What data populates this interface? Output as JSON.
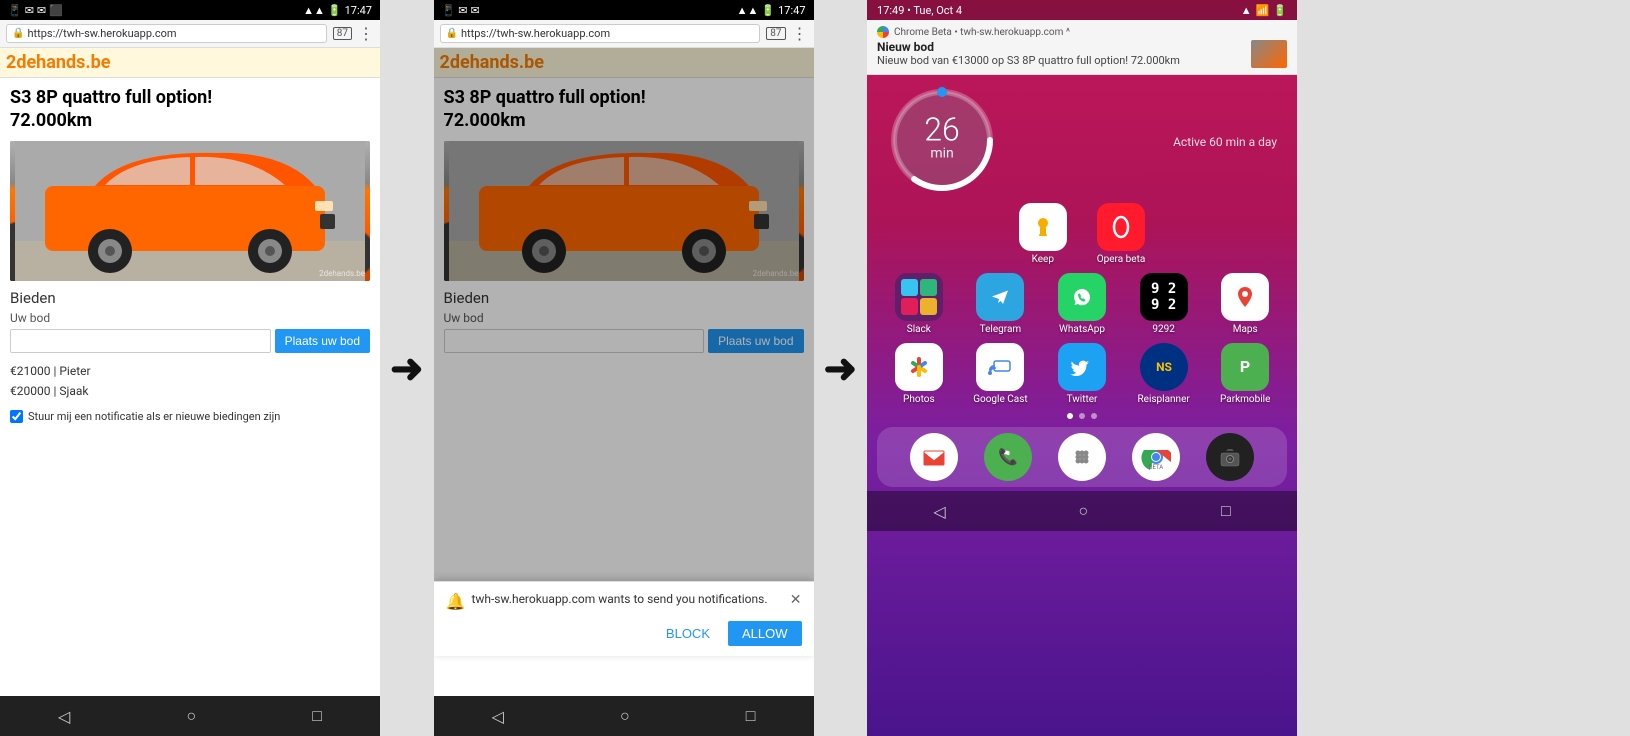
{
  "screens": {
    "screen1": {
      "status_bar": {
        "left_icons": "📱 ✉ ✉ 📸",
        "time": "17:47",
        "right_icons": "📶 🔋"
      },
      "browser": {
        "url": "https://twh-sw.herokuapp.com",
        "tab_count": "87",
        "menu": "⋮"
      },
      "site": {
        "number": "2",
        "name": "dehands.be"
      },
      "listing": {
        "title": "S3 8P quattro full option!\n72.000km"
      },
      "car_watermark": "2dehands.be",
      "bieden": "Bieden",
      "uw_bod": "Uw bod",
      "bid_button": "Plaats uw bod",
      "bids": [
        "€21000 | Pieter",
        "€20000 | Sjaak"
      ],
      "checkbox_label": "Stuur mij een notificatie als er nieuwe biedingen zijn"
    },
    "screen2": {
      "status_bar": {
        "time": "17:47"
      },
      "browser": {
        "url": "https://twh-sw.herokuapp.com",
        "tab_count": "87"
      },
      "site": {
        "number": "2",
        "name": "dehands.be"
      },
      "listing": {
        "title": "S3 8P quattro full option!\n72.000km"
      },
      "car_watermark": "2dehands.be",
      "bieden": "Bieden",
      "uw_bod": "Uw bod",
      "bid_button": "Plaats uw bod",
      "notification": {
        "text": "twh-sw.herokuapp.com wants to send you notifications.",
        "block": "BLOCK",
        "allow": "ALLOW"
      }
    },
    "screen3": {
      "status_bar": {
        "time": "17:49 • Tue, Oct 4"
      },
      "notification_banner": {
        "app": "Chrome Beta • twh-sw.herokuapp.com ^",
        "title": "Nieuw bod",
        "body": "Nieuw bod van €13000 op S3 8P quattro full option! 72.000km"
      },
      "clock": {
        "number": "26",
        "unit": "min",
        "active_text": "Active 60 min a day"
      },
      "apps_row1": [
        {
          "name": "Keep",
          "icon_type": "keep"
        },
        {
          "name": "Opera beta",
          "icon_type": "opera"
        }
      ],
      "apps_row2": [
        {
          "name": "Slack",
          "icon_type": "slack"
        },
        {
          "name": "Telegram",
          "icon_type": "telegram"
        },
        {
          "name": "WhatsApp",
          "icon_type": "whatsapp"
        },
        {
          "name": "9292",
          "icon_type": "9292"
        },
        {
          "name": "Maps",
          "icon_type": "maps"
        }
      ],
      "apps_row3": [
        {
          "name": "Photos",
          "icon_type": "photos"
        },
        {
          "name": "Google Cast",
          "icon_type": "cast"
        },
        {
          "name": "Twitter",
          "icon_type": "twitter"
        },
        {
          "name": "Reisplanner",
          "icon_type": "reisplanner"
        },
        {
          "name": "Parkmobile",
          "icon_type": "parkmobile"
        }
      ],
      "dock": [
        {
          "name": "Gmail",
          "icon_type": "gmail"
        },
        {
          "name": "Phone",
          "icon_type": "phone"
        },
        {
          "name": "Launcher",
          "icon_type": "launcher"
        },
        {
          "name": "Chrome Beta",
          "icon_type": "chrome"
        },
        {
          "name": "Camera",
          "icon_type": "camera"
        }
      ]
    }
  },
  "arrows": {
    "label": "→"
  }
}
